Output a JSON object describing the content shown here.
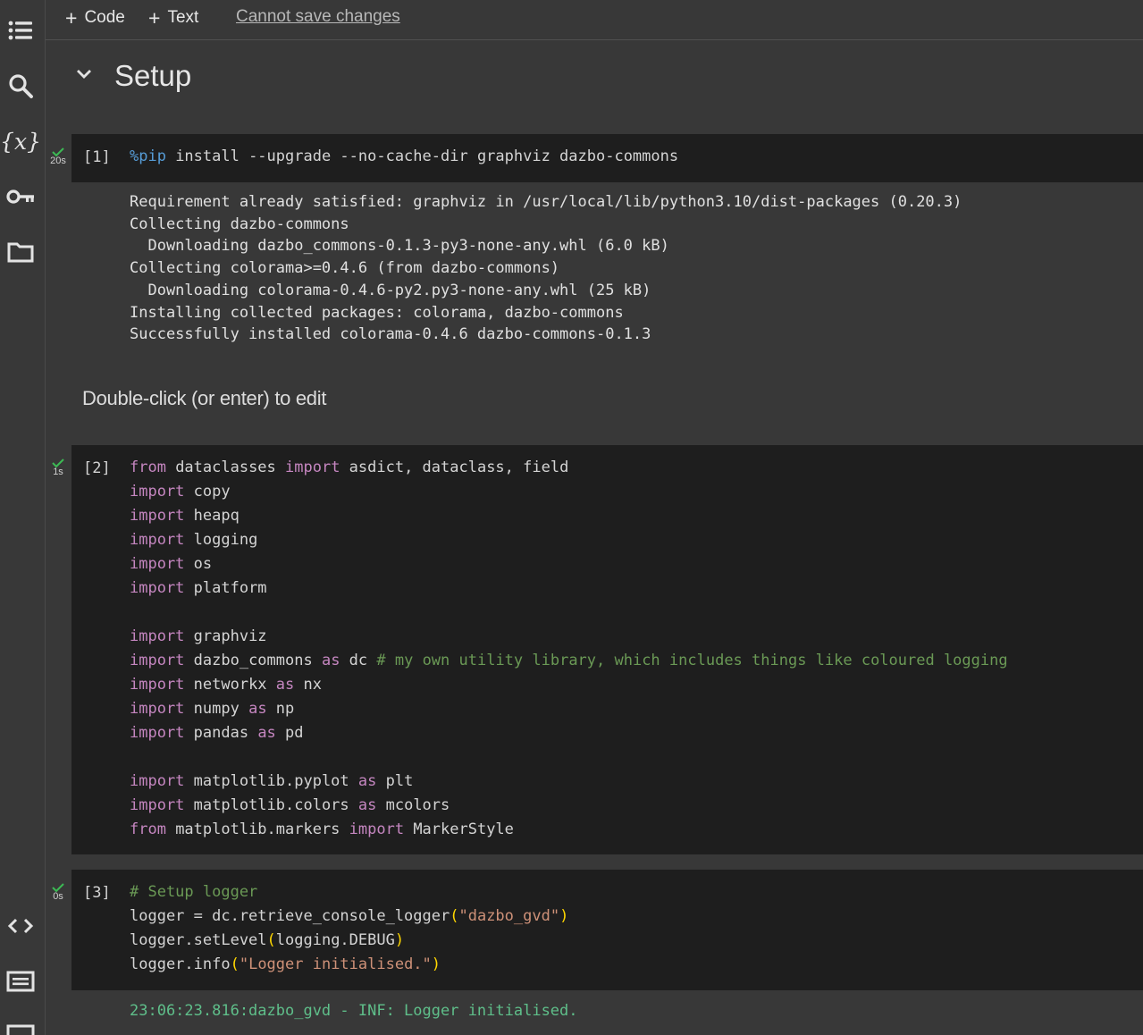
{
  "toolbar": {
    "code_label": "Code",
    "text_label": "Text",
    "status": "Cannot save changes"
  },
  "section": {
    "title": "Setup"
  },
  "cells": {
    "c1": {
      "prompt": "[1]",
      "time": "20s",
      "magic": "%pip",
      "rest": " install --upgrade --no-cache-dir graphviz dazbo-commons",
      "output": "Requirement already satisfied: graphviz in /usr/local/lib/python3.10/dist-packages (0.20.3)\nCollecting dazbo-commons\n  Downloading dazbo_commons-0.1.3-py3-none-any.whl (6.0 kB)\nCollecting colorama>=0.4.6 (from dazbo-commons)\n  Downloading colorama-0.4.6-py2.py3-none-any.whl (25 kB)\nInstalling collected packages: colorama, dazbo-commons\nSuccessfully installed colorama-0.4.6 dazbo-commons-0.1.3"
    },
    "text_cell": "Double-click (or enter) to edit",
    "c2": {
      "prompt": "[2]",
      "time": "1s",
      "lines": [
        {
          "k1": "from",
          "a": " dataclasses ",
          "k2": "import",
          "b": " asdict, dataclass, field"
        },
        {
          "k1": "import",
          "a": " copy"
        },
        {
          "k1": "import",
          "a": " heapq"
        },
        {
          "k1": "import",
          "a": " logging"
        },
        {
          "k1": "import",
          "a": " os"
        },
        {
          "k1": "import",
          "a": " platform"
        },
        {},
        {
          "k1": "import",
          "a": " graphviz"
        },
        {
          "k1": "import",
          "a": " dazbo_commons ",
          "k2": "as",
          "b": " dc ",
          "c": "# my own utility library, which includes things like coloured logging"
        },
        {
          "k1": "import",
          "a": " networkx ",
          "k2": "as",
          "b": " nx"
        },
        {
          "k1": "import",
          "a": " numpy ",
          "k2": "as",
          "b": " np"
        },
        {
          "k1": "import",
          "a": " pandas ",
          "k2": "as",
          "b": " pd"
        },
        {},
        {
          "k1": "import",
          "a": " matplotlib.pyplot ",
          "k2": "as",
          "b": " plt"
        },
        {
          "k1": "import",
          "a": " matplotlib.colors ",
          "k2": "as",
          "b": " mcolors"
        },
        {
          "k1": "from",
          "a": " matplotlib.markers ",
          "k2": "import",
          "b": " MarkerStyle"
        }
      ]
    },
    "c3": {
      "prompt": "[3]",
      "time": "0s",
      "l1": "# Setup logger",
      "l2a": "logger = dc.retrieve_console_logger",
      "l2s": "\"dazbo_gvd\"",
      "l3a": "logger.setLevel",
      "l3b": "logging.DEBUG",
      "l4a": "logger.info",
      "l4s": "\"Logger initialised.\"",
      "output": "23:06:23.816:dazbo_gvd - INF: Logger initialised."
    }
  },
  "icons": [
    "toc-icon",
    "search-icon",
    "variables-icon",
    "key-icon",
    "folder-icon",
    "code-snippets-icon",
    "terminal-icon"
  ]
}
